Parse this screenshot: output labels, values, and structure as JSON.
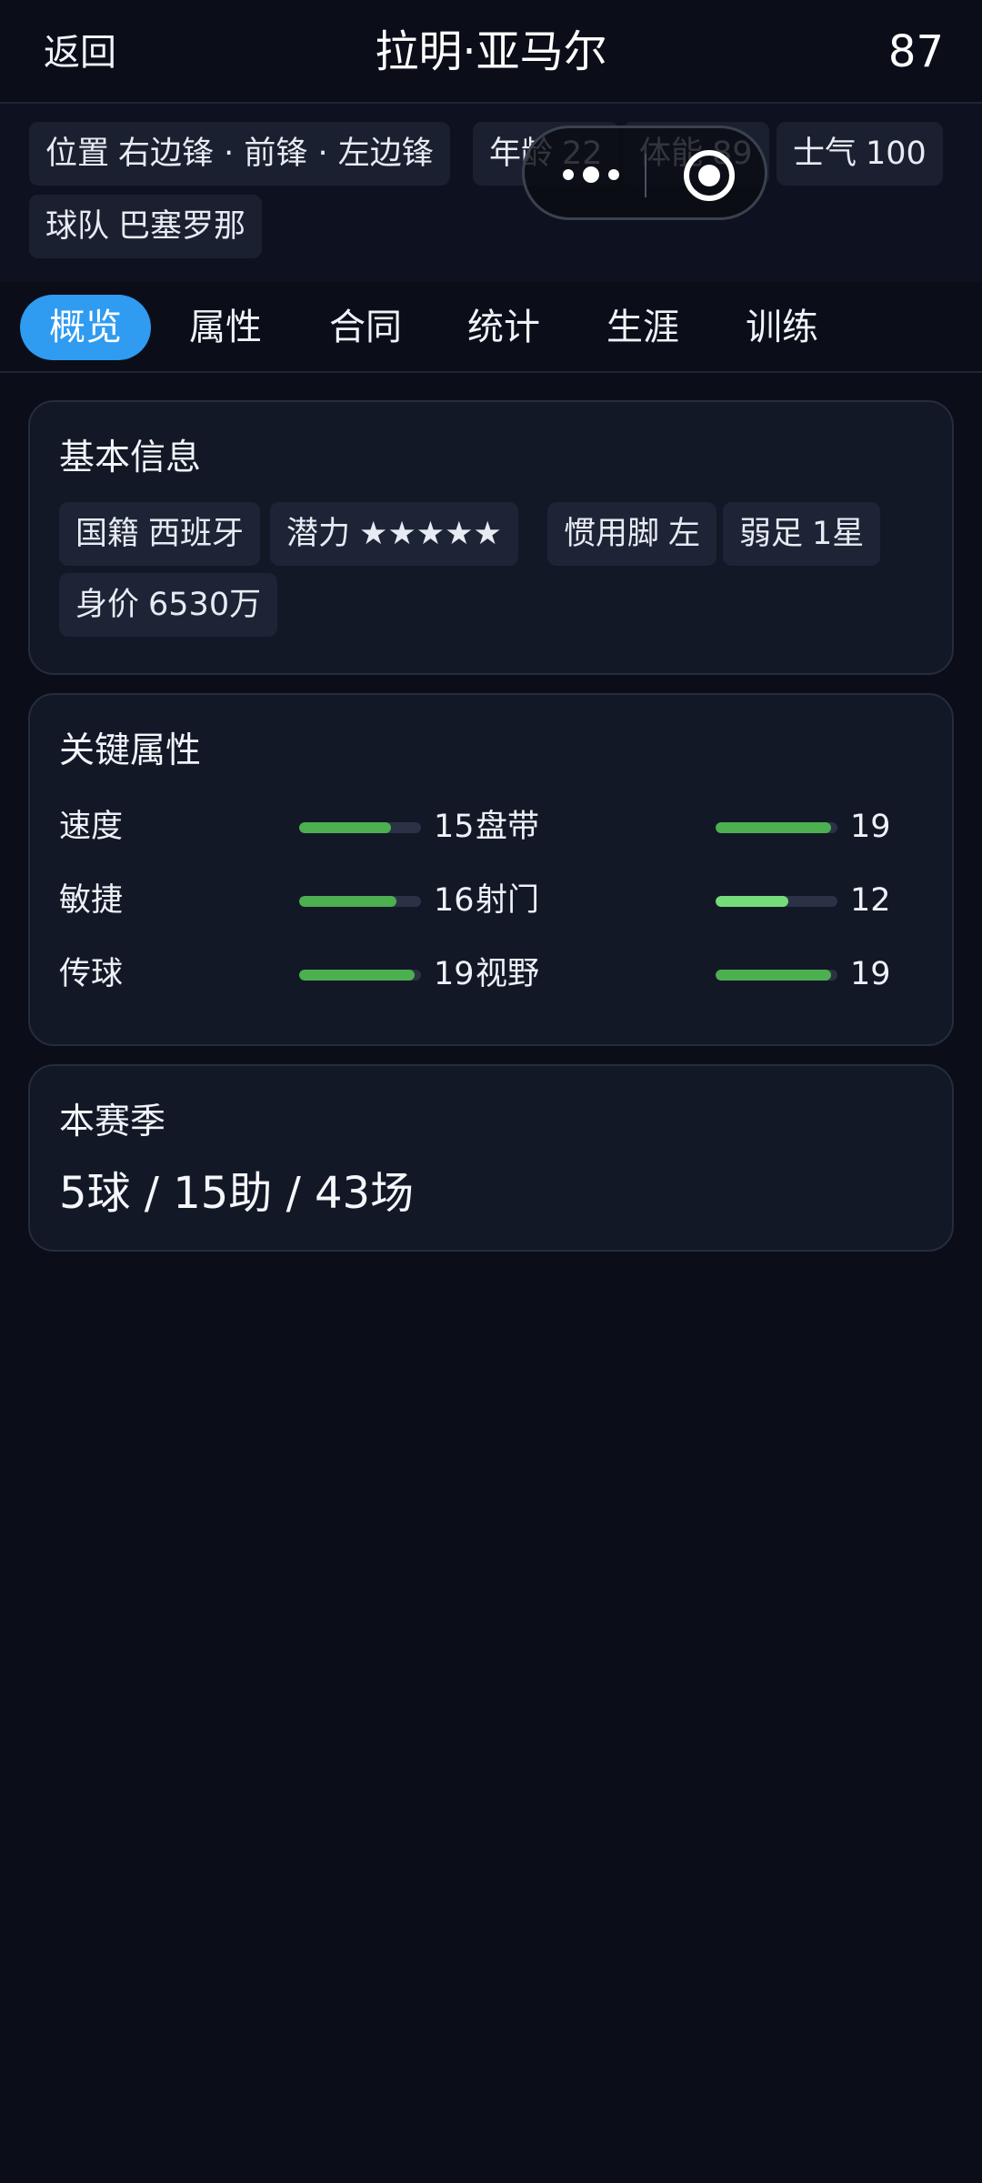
{
  "topbar": {
    "back_label": "返回",
    "title": "拉明·亚马尔",
    "rating": "87"
  },
  "header": {
    "chips": [
      {
        "label": "位置",
        "value": "右边锋 · 前锋 · 左边锋"
      },
      {
        "label": "年龄",
        "value": "22"
      },
      {
        "label": "体能",
        "value": "89"
      },
      {
        "label": "士气",
        "value": "100"
      },
      {
        "label": "球队",
        "value": "巴塞罗那"
      }
    ]
  },
  "capsule": {
    "more_icon": "more-dots-icon",
    "close_icon": "target-circle-icon"
  },
  "tabs": [
    {
      "label": "概览",
      "active": true
    },
    {
      "label": "属性",
      "active": false
    },
    {
      "label": "合同",
      "active": false
    },
    {
      "label": "统计",
      "active": false
    },
    {
      "label": "生涯",
      "active": false
    },
    {
      "label": "训练",
      "active": false
    }
  ],
  "basic_info": {
    "title": "基本信息",
    "chips": [
      {
        "label": "国籍",
        "value": "西班牙"
      },
      {
        "label": "潜力",
        "value": "★★★★★"
      },
      {
        "label": "惯用脚",
        "value": "左"
      },
      {
        "label": "弱足",
        "value": "1星"
      },
      {
        "label": "身价",
        "value": "6530万"
      }
    ]
  },
  "key_attributes": {
    "title": "关键属性",
    "max_value": 20,
    "rows": [
      {
        "left": {
          "label": "速度",
          "value": 15
        },
        "right": {
          "label": "盘带",
          "value": 19
        }
      },
      {
        "left": {
          "label": "敏捷",
          "value": 16
        },
        "right": {
          "label": "射门",
          "value": 12
        }
      },
      {
        "left": {
          "label": "传球",
          "value": 19
        },
        "right": {
          "label": "视野",
          "value": 19
        }
      }
    ],
    "colors": {
      "bar_fill": "#4caf50",
      "bar_fill_mid": "#74dc79",
      "bar_track": "#2b3246"
    }
  },
  "season": {
    "title": "本赛季",
    "summary": "5球 / 15助 / 43场"
  },
  "colors": {
    "background": "#0b0e18",
    "card": "#131827",
    "accent": "#2f9bf1"
  }
}
